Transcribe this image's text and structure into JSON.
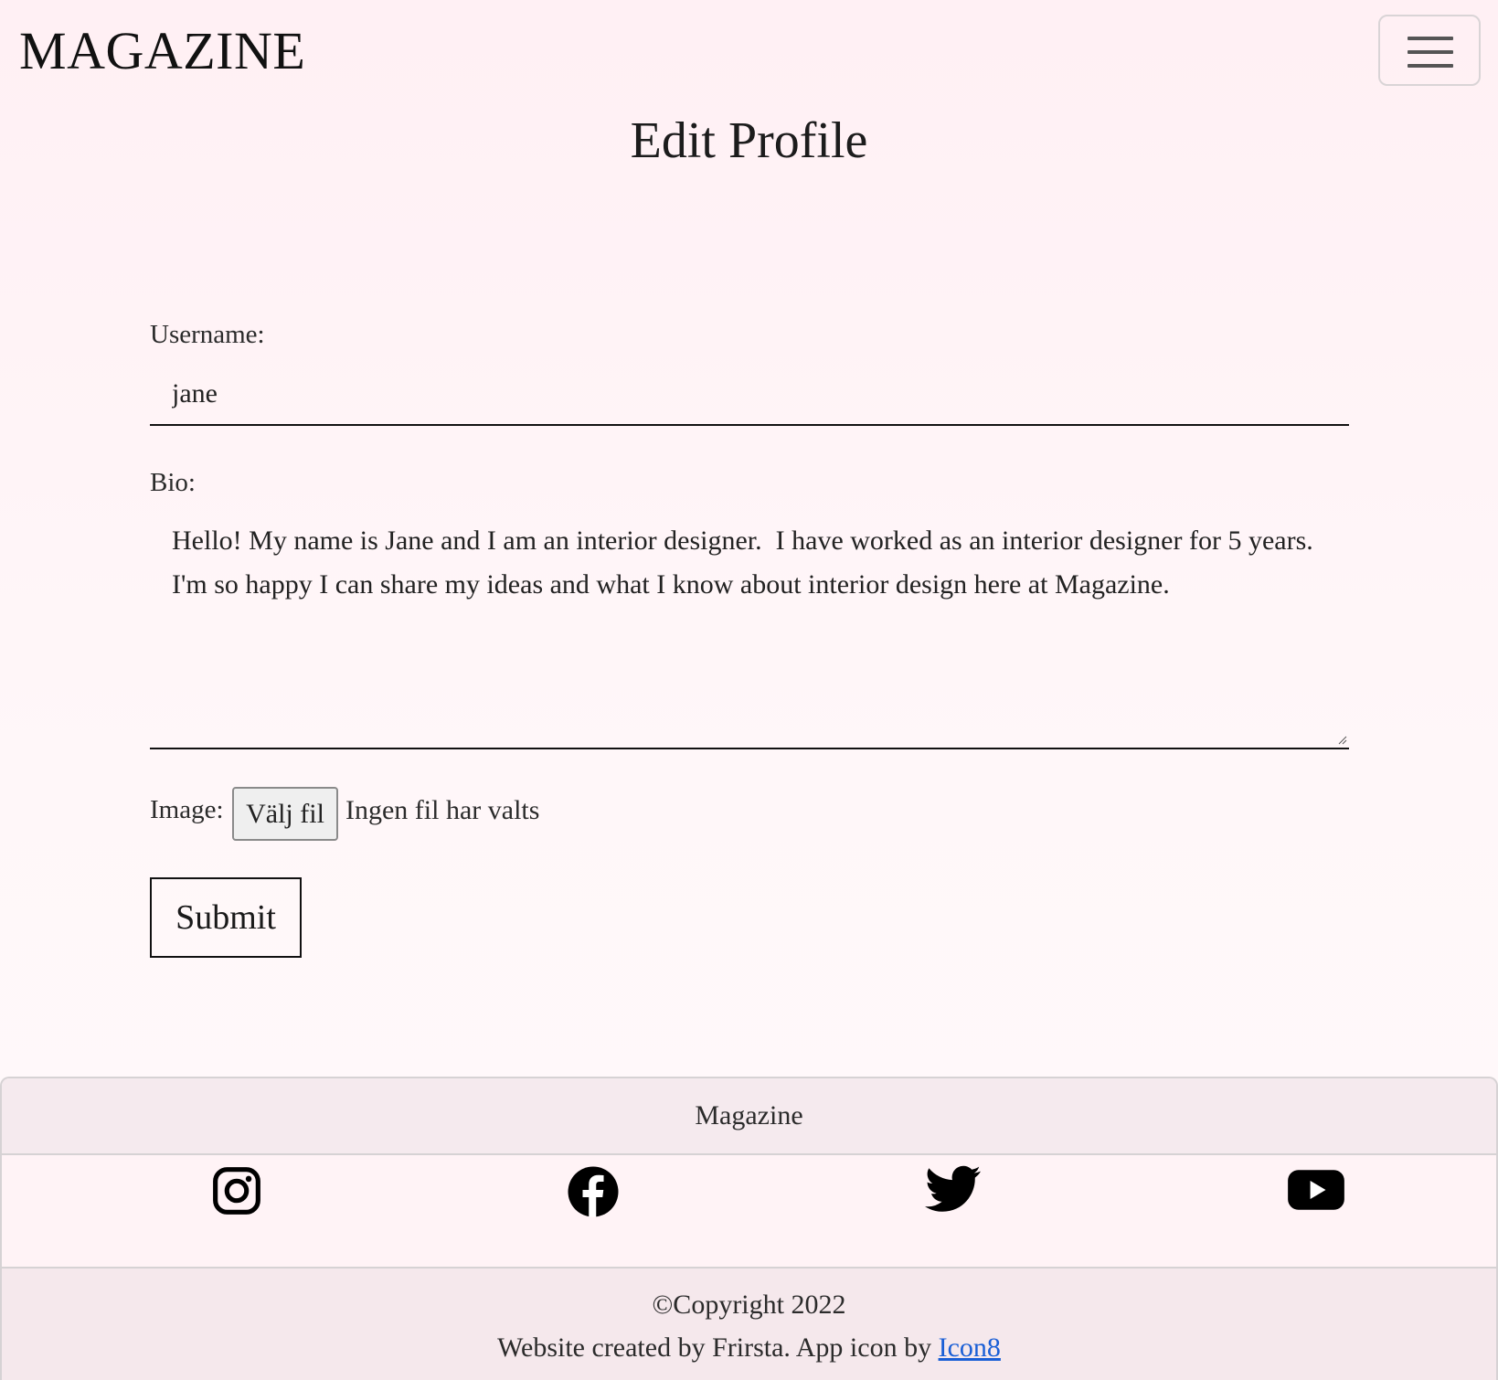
{
  "navbar": {
    "brand": "MAGAZINE",
    "toggler_icon": "hamburger-menu-icon"
  },
  "page": {
    "title": "Edit Profile"
  },
  "form": {
    "username_label": "Username:",
    "username_value": "jane",
    "bio_label": "Bio:",
    "bio_value": "Hello! My name is Jane and I am an interior designer.  I have worked as an interior designer for 5 years. I'm so happy I can share my ideas and what I know about interior design here at Magazine.",
    "image_label": "Image:",
    "file_button_label": "Välj fil",
    "file_status": "Ingen fil har valts",
    "submit_label": "Submit"
  },
  "footer": {
    "title": "Magazine",
    "social": [
      {
        "name": "instagram-icon"
      },
      {
        "name": "facebook-icon"
      },
      {
        "name": "twitter-icon"
      },
      {
        "name": "youtube-icon"
      }
    ],
    "copyright": "©Copyright 2022",
    "credit_text": "Website created by Frirsta. App icon by ",
    "credit_link": "Icon8"
  },
  "colors": {
    "background": "#fff0f4",
    "footer_band": "#f5eaee",
    "link": "#1a5fd6",
    "text": "#212529"
  }
}
